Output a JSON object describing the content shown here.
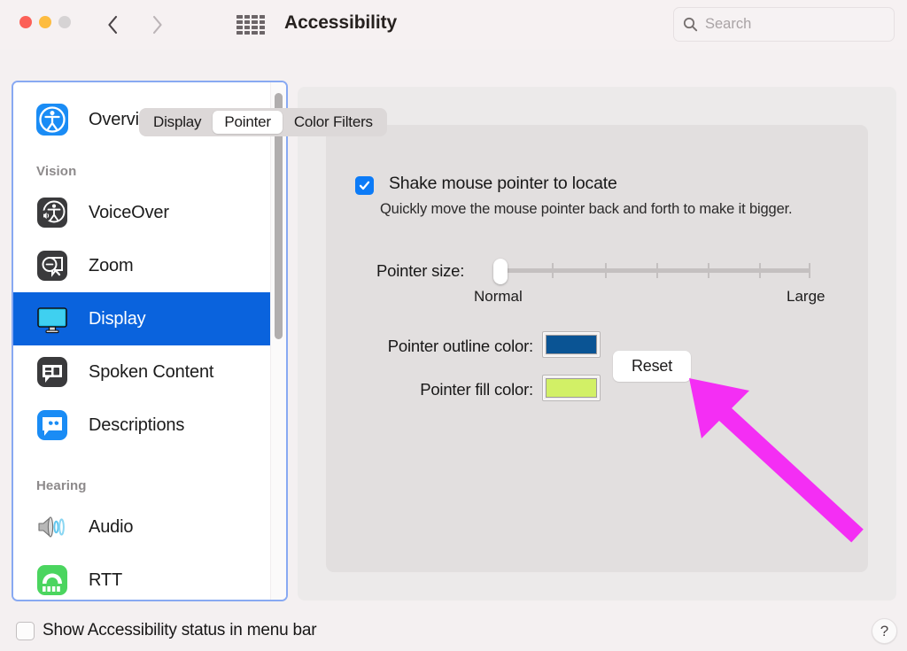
{
  "window": {
    "title": "Accessibility",
    "traffic_lights": [
      "close",
      "minimize",
      "zoom-disabled"
    ]
  },
  "toolbar": {
    "back_icon": "chevron-left-icon",
    "forward_icon": "chevron-right-icon",
    "grid_icon": "show-all-grid-icon",
    "search_placeholder": "Search",
    "search_value": "",
    "search_icon": "search-icon"
  },
  "sidebar": {
    "items": [
      {
        "label": "Overview",
        "icon": "accessibility-person-icon",
        "selected": false
      },
      {
        "label": "Vision",
        "type": "header"
      },
      {
        "label": "VoiceOver",
        "icon": "voiceover-icon",
        "selected": false
      },
      {
        "label": "Zoom",
        "icon": "zoom-magnifier-icon",
        "selected": false
      },
      {
        "label": "Display",
        "icon": "display-monitor-icon",
        "selected": true
      },
      {
        "label": "Spoken Content",
        "icon": "spoken-content-bubble-icon",
        "selected": false
      },
      {
        "label": "Descriptions",
        "icon": "descriptions-quote-bubble-icon",
        "selected": false
      },
      {
        "label": "Hearing",
        "type": "header"
      },
      {
        "label": "Audio",
        "icon": "audio-speaker-icon",
        "selected": false
      },
      {
        "label": "RTT",
        "icon": "rtt-phone-icon",
        "selected": false
      }
    ],
    "selection_color": "#0a63dd",
    "focus_ring_color": "#88a9f2"
  },
  "main": {
    "tabs": [
      {
        "label": "Display",
        "active": false
      },
      {
        "label": "Pointer",
        "active": true
      },
      {
        "label": "Color Filters",
        "active": false
      }
    ],
    "shake_checkbox": {
      "label": "Shake mouse pointer to locate",
      "checked": true,
      "description": "Quickly move the mouse pointer back and forth to make it bigger."
    },
    "pointer_size": {
      "label": "Pointer size:",
      "min_label": "Normal",
      "max_label": "Large",
      "value": 0,
      "tick_count": 6
    },
    "outline_color": {
      "label": "Pointer outline color:",
      "value": "#0a5494"
    },
    "fill_color": {
      "label": "Pointer fill color:",
      "value": "#d2f066"
    },
    "reset_button": "Reset"
  },
  "annotation": {
    "arrow_color": "#f42ef4",
    "points_to": "Reset"
  },
  "bottom": {
    "status_checkbox_label": "Show Accessibility status in menu bar",
    "status_checked": false,
    "help_label": "?"
  }
}
